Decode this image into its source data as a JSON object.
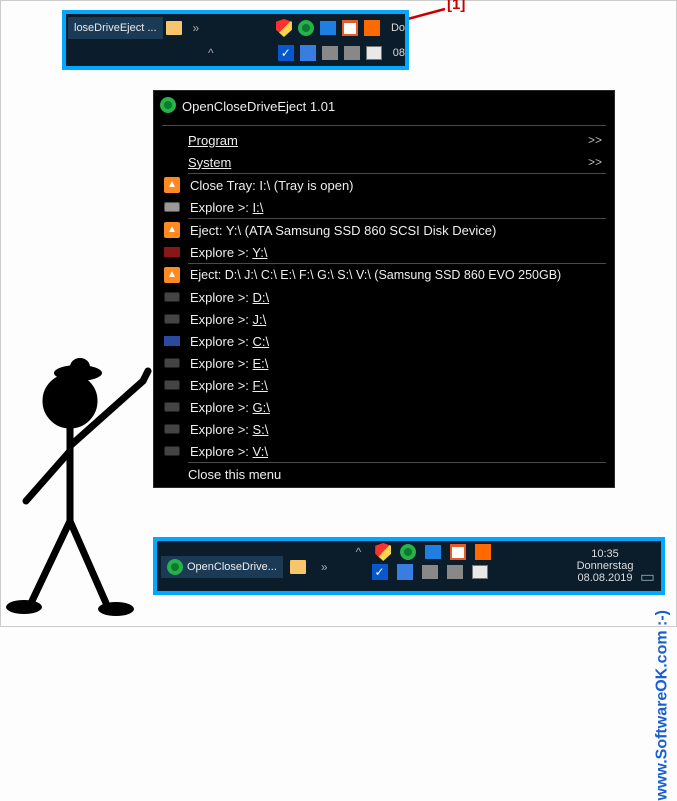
{
  "annotation": {
    "label": "[1]"
  },
  "topbar": {
    "task_label": "loseDriveEject ...",
    "overflow": "»",
    "time_fragment": "Do",
    "date_fragment": "08"
  },
  "menu": {
    "title": "OpenCloseDriveEject 1.01",
    "program_label": "Program",
    "system_label": "System",
    "arrow": ">>",
    "close_tray": {
      "label": "Close Tray: I:\\ (Tray is open)",
      "explore": "Explore >: ",
      "drive": "I:\\"
    },
    "eject_y": {
      "label": "Eject: Y:\\  (ATA Samsung SSD 860 SCSI Disk Device)",
      "explore": "Explore >: ",
      "drive": "Y:\\"
    },
    "eject_multi": {
      "label": "Eject: D:\\ J:\\ C:\\ E:\\ F:\\ G:\\ S:\\ V:\\  (Samsung SSD 860 EVO 250GB)",
      "explore": "Explore >: ",
      "drives": [
        "D:\\",
        "J:\\",
        "C:\\",
        "E:\\",
        "F:\\",
        "G:\\",
        "S:\\",
        "V:\\"
      ]
    },
    "close_menu": "Close this menu"
  },
  "bottombar": {
    "task_label": "OpenCloseDrive...",
    "time": "10:35",
    "weekday": "Donnerstag",
    "date": "08.08.2019"
  },
  "watermark": "www.SoftwareOK.com :-)"
}
